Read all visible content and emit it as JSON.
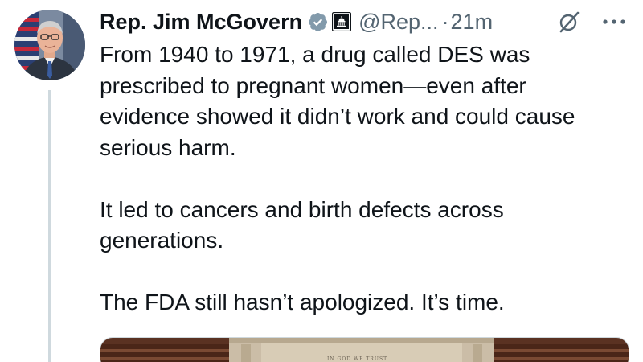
{
  "author": {
    "display_name": "Rep. Jim McGovern",
    "handle": "@Rep...",
    "separator": "·",
    "time": "21m",
    "verified_badge": "blue-check",
    "affiliation_badge": "us-capitol"
  },
  "actions": {
    "grok_icon": "grok-icon",
    "more_icon": "more-icon"
  },
  "tweet": {
    "paragraphs": [
      "From 1940 to 1971, a drug called DES was\nprescribed to pregnant women—even after\nevidence showed it didn’t work and could cause\nserious harm.",
      "It led to cancers and birth defects across\ngenerations.",
      "The FDA still hasn’t apologized. It’s time."
    ]
  },
  "media": {
    "caption": "IN GOD WE TRUST"
  },
  "colors": {
    "text": "#0f1419",
    "secondary": "#536471",
    "verified": "#829aab",
    "thread_line": "#cfd9de"
  }
}
